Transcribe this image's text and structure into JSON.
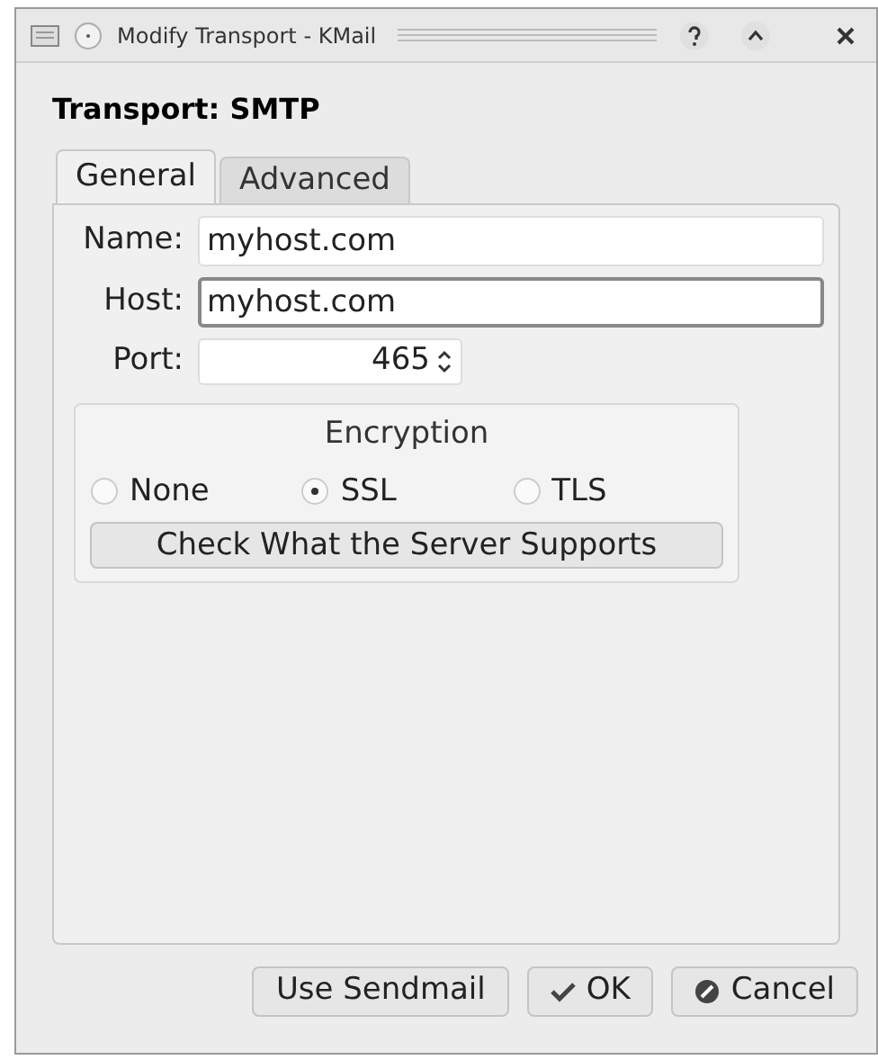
{
  "window": {
    "title": "Modify Transport - KMail"
  },
  "heading": "Transport: SMTP",
  "tabs": [
    {
      "label": "General",
      "selected": true
    },
    {
      "label": "Advanced",
      "selected": false
    }
  ],
  "fields": [
    {
      "label": "Name:",
      "value": "myhost.com",
      "focused": false
    },
    {
      "label": "Host:",
      "value": "myhost.com",
      "focused": true
    }
  ],
  "port": {
    "label": "Port:",
    "value": "465"
  },
  "encryption": {
    "title": "Encryption",
    "options": [
      {
        "label": "None",
        "selected": false
      },
      {
        "label": "SSL",
        "selected": true
      },
      {
        "label": "TLS",
        "selected": false
      }
    ],
    "button": "Check What the Server Supports"
  },
  "buttons": [
    {
      "kind": "plain",
      "label": "Use Sendmail"
    },
    {
      "kind": "ok",
      "label": "OK"
    },
    {
      "kind": "cancel",
      "label": "Cancel"
    }
  ]
}
